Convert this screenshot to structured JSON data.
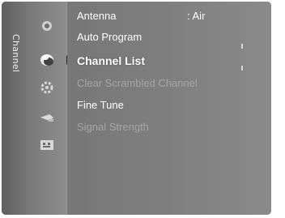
{
  "sidebar": {
    "label": "Channel",
    "icons": [
      "picture-icon",
      "channel-icon",
      "setup-icon",
      "input-icon",
      "application-icon"
    ]
  },
  "menu": {
    "items": [
      {
        "label": "Antenna",
        "value": ": Air",
        "state": "normal"
      },
      {
        "label": "Auto Program",
        "value": "",
        "state": "normal"
      },
      {
        "label": "Channel List",
        "value": "",
        "state": "selected"
      },
      {
        "label": "Clear Scrambled Channel",
        "value": "",
        "state": "disabled"
      },
      {
        "label": "Fine Tune",
        "value": "",
        "state": "normal"
      },
      {
        "label": "Signal Strength",
        "value": "",
        "state": "disabled"
      }
    ]
  },
  "colors": {
    "frame": "#6e6e6e",
    "highlight": "#c8c8c8",
    "text": "#ffffff",
    "disabled_text": "#a5a5a5"
  }
}
